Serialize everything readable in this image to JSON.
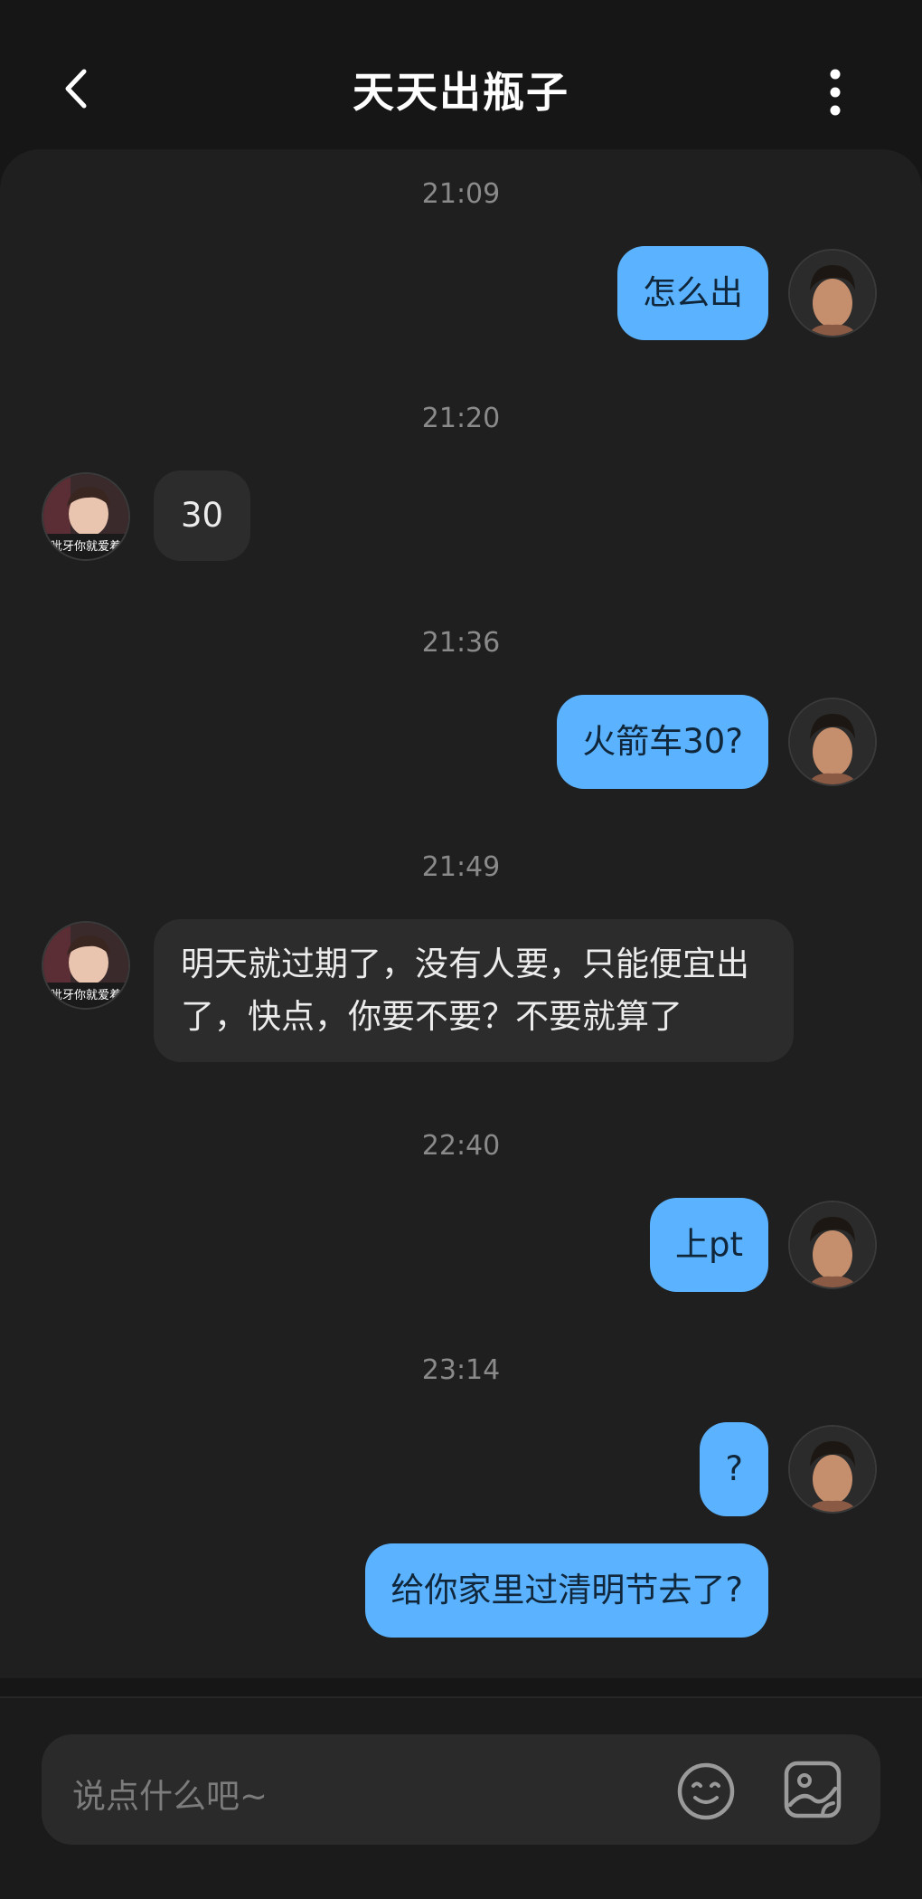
{
  "header": {
    "title": "天天出瓶子"
  },
  "messages": [
    {
      "time": "21:09",
      "side": "out",
      "text": "怎么出"
    },
    {
      "time": "21:20",
      "side": "in",
      "text": "30",
      "avatar_caption": "呲牙你就爱着"
    },
    {
      "time": "21:36",
      "side": "out",
      "text": "火箭车30?"
    },
    {
      "time": "21:49",
      "side": "in",
      "text": "明天就过期了，没有人要，只能便宜出了，快点，你要不要？不要就算了",
      "avatar_caption": "呲牙你就爱着"
    },
    {
      "time": "22:40",
      "side": "out",
      "text": "上pt"
    },
    {
      "time": "23:14",
      "side": "out",
      "text": "?"
    },
    {
      "time": "",
      "side": "out",
      "text": "给你家里过清明节去了?"
    }
  ],
  "composer": {
    "placeholder": "说点什么吧~",
    "emoji_icon": "smile-emoji-icon",
    "image_icon": "image-sticker-icon"
  },
  "colors": {
    "background": "#161616",
    "chat_background": "#1f1f1f",
    "outgoing_bubble": "#5bb3ff",
    "incoming_bubble": "#2c2c2c",
    "timestamp": "#8a8a8a"
  }
}
